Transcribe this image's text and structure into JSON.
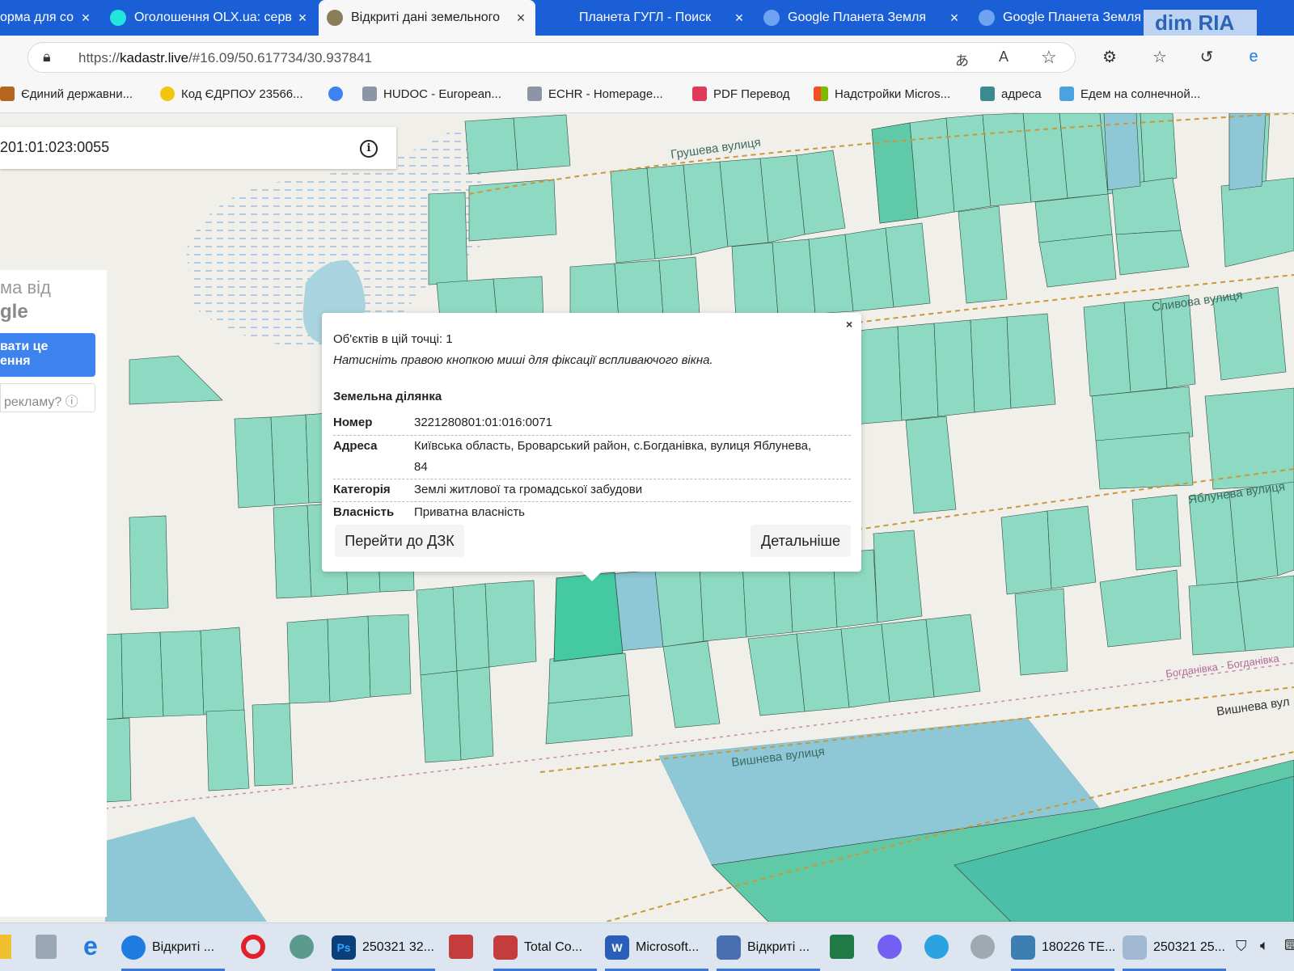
{
  "browser": {
    "tabs": [
      {
        "title": "орма для со",
        "icon_color": "#ffffff",
        "icon": "doc-icon"
      },
      {
        "title": "Оголошення OLX.ua: серв",
        "icon_color": "#23e5db",
        "icon": "olx-icon"
      },
      {
        "title": "Відкриті дані земельного",
        "icon_color": "#8b7d5a",
        "icon": "kadastr-icon",
        "active": true
      },
      {
        "title": "Планета ГУГЛ - Поиск",
        "icon_color": "#1a5fd6",
        "icon": "search-icon"
      },
      {
        "title": "Google Планета Земля",
        "icon_color": "#6fa3ef",
        "icon": "earth-icon"
      },
      {
        "title": "Google Планета Земля",
        "icon_color": "#6fa3ef",
        "icon": "earth-icon"
      }
    ],
    "close_glyph": "×",
    "overlay_logo": "dim RIA",
    "url_prefix": "https://",
    "url_host": "kadastr.live",
    "url_path": "/#16.09/50.617734/30.937841",
    "bookmarks": [
      "Єдиний державни...",
      "Код ЄДРПОУ 23566...",
      "",
      "HUDOC - European...",
      "ECHR - Homepage...",
      "PDF Перевод",
      "Надстройки Micros...",
      "адреса",
      "Едем на солнечной..."
    ]
  },
  "map": {
    "search_value": "201:01:023:0055",
    "street_labels": [
      "Грушева вулиця",
      "Сливова вулиця",
      "Яблунева вулиця",
      "Вишнева вулиця",
      "Вишнева вул",
      "Богданівка - Богданівка"
    ],
    "colors": {
      "parcel": "#8dd9c1",
      "parcel_dark": "#5fc9a8",
      "parcel_selected": "#45c9a0",
      "parcel_blue": "#8ec8d6",
      "water_blue": "#a9d3de",
      "road_dash": "#c9983a"
    }
  },
  "ad": {
    "title1": "ма від",
    "title2": "gle",
    "button": "вати це\nення",
    "why": "рекламу? ⓘ"
  },
  "popup": {
    "close": "×",
    "count_line": "Об'єктів в цій точці: 1",
    "hint": "Натисніть правою кнопкою миші для фіксації вспливаючого вікна.",
    "heading": "Земельна ділянка",
    "rows": [
      {
        "label": "Номер",
        "value": "3221280801:01:016:0071"
      },
      {
        "label": "Адреса",
        "value": "Київська область, Броварський район, с.Богданівка, вулиця Яблунева,",
        "value2": "84"
      },
      {
        "label": "Категорія",
        "value": "Землі житлової та громадської забудови"
      },
      {
        "label": "Власність",
        "value": "Приватна власність"
      }
    ],
    "btn_dzk": "Перейти до ДЗК",
    "btn_more": "Детальніше"
  },
  "taskbar": {
    "items": [
      {
        "label": "Відкриті ...",
        "color": "#1e7be0"
      },
      {
        "label": "250321 32...",
        "color": "#0a3f7a",
        "glyph": "Ps"
      },
      {
        "label": "Total Co...",
        "color": "#c53c3c"
      },
      {
        "label": "Microsoft...",
        "color": "#2a5eb8",
        "glyph": "W"
      },
      {
        "label": "Відкриті ...",
        "color": "#4a6fb0"
      },
      {
        "label": "180226 TE...",
        "color": "#3d7fb0"
      },
      {
        "label": "250321 25...",
        "color": "#a0b8d0"
      }
    ]
  }
}
